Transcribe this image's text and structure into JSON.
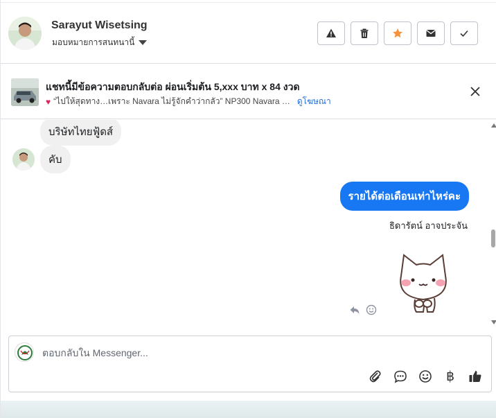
{
  "header": {
    "contact_name": "Sarayut Wisetsing",
    "assign_label": "มอบหมายการสนทนานี้",
    "actions": [
      {
        "name": "report-spam-button",
        "icon": "warning-icon"
      },
      {
        "name": "delete-button",
        "icon": "trash-icon"
      },
      {
        "name": "star-button",
        "icon": "star-icon",
        "color": "#f7923b"
      },
      {
        "name": "mark-unread-button",
        "icon": "envelope-icon"
      },
      {
        "name": "mark-done-button",
        "icon": "check-icon"
      }
    ]
  },
  "ad_banner": {
    "title": "แชทนี้มีข้อความตอบกลับต่อ ผ่อนเริ่มต้น 5,xxx บาท x 84 งวด",
    "subtitle": "“ไปให้สุดทาง…เพราะ Navara ไม่รู้จักคำว่ากลัว”  NP300 Navara …",
    "link_label": "ดูโฆษณา"
  },
  "messages": [
    {
      "direction": "in",
      "text": "บริษัทไทยฟู้ดส์"
    },
    {
      "direction": "in",
      "text": "คับ"
    },
    {
      "direction": "out",
      "text": "รายได้ต่อเดือนเท่าไหร่คะ"
    }
  ],
  "sender_name": "ธิดารัตน์ อาจประจัน",
  "composer": {
    "placeholder": "ตอบกลับใน Messenger..."
  },
  "colors": {
    "accent": "#1877f2",
    "star": "#f7923b"
  }
}
